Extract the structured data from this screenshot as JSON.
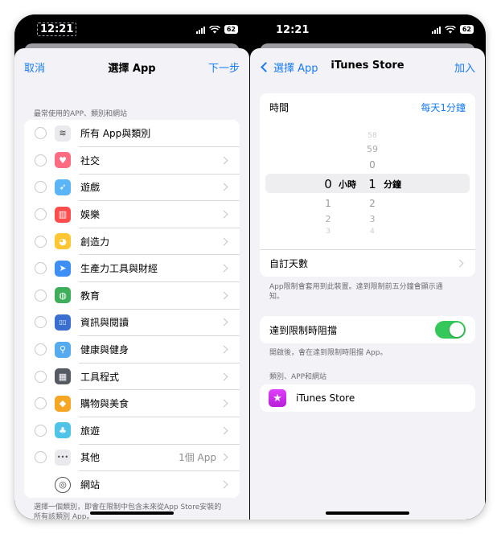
{
  "status": {
    "time": "12:21",
    "battery": "62"
  },
  "left": {
    "nav": {
      "cancel": "取消",
      "title": "選擇 App",
      "next": "下一步"
    },
    "section_header": "最常使用的APP、類別和網站",
    "rows": [
      {
        "label": "所有 App與類別",
        "icon": "stack-icon",
        "glyph": "≋",
        "color": "#e9e9ee",
        "detail": "",
        "chevron": false,
        "radio": true
      },
      {
        "label": "社交",
        "icon": "social-heart-icon",
        "glyph": "♥",
        "color": "#ff6b81",
        "detail": "",
        "chevron": true,
        "radio": true
      },
      {
        "label": "遊戲",
        "icon": "rocket-icon",
        "glyph": "➶",
        "color": "#5ab4f5",
        "detail": "",
        "chevron": true,
        "radio": true
      },
      {
        "label": "娛樂",
        "icon": "popcorn-icon",
        "glyph": "▥",
        "color": "#ff4d4d",
        "detail": "",
        "chevron": true,
        "radio": true
      },
      {
        "label": "創造力",
        "icon": "palette-icon",
        "glyph": "◕",
        "color": "#ffc633",
        "detail": "",
        "chevron": true,
        "radio": true
      },
      {
        "label": "生產力工具與財經",
        "icon": "paper-plane-icon",
        "glyph": "➤",
        "color": "#3d8ff5",
        "detail": "",
        "chevron": true,
        "radio": true
      },
      {
        "label": "教育",
        "icon": "globe-icon",
        "glyph": "◍",
        "color": "#3fae5a",
        "detail": "",
        "chevron": true,
        "radio": true
      },
      {
        "label": "資訊與閱讀",
        "icon": "book-icon",
        "glyph": "▯▯",
        "color": "#3a6fcf",
        "detail": "",
        "chevron": true,
        "radio": true
      },
      {
        "label": "健康與健身",
        "icon": "bicycle-icon",
        "glyph": "⚲",
        "color": "#55aaf0",
        "detail": "",
        "chevron": true,
        "radio": true
      },
      {
        "label": "工具程式",
        "icon": "calculator-icon",
        "glyph": "▦",
        "color": "#555a63",
        "detail": "",
        "chevron": true,
        "radio": true
      },
      {
        "label": "購物與美食",
        "icon": "shopping-bag-icon",
        "glyph": "◆",
        "color": "#f5a623",
        "detail": "",
        "chevron": true,
        "radio": true
      },
      {
        "label": "旅遊",
        "icon": "palm-tree-icon",
        "glyph": "♣",
        "color": "#4fc3e8",
        "detail": "",
        "chevron": true,
        "radio": true
      },
      {
        "label": "其他",
        "icon": "more-dots-icon",
        "glyph": "•••",
        "color": "#e9e9ee",
        "detail": "1個 App",
        "chevron": true,
        "radio": true
      },
      {
        "label": "網站",
        "icon": "compass-icon",
        "glyph": "◎",
        "color": "#ffffff",
        "detail": "",
        "chevron": true,
        "radio": false
      }
    ],
    "footer": "選擇一個類別，即會在限制中包含未來從App Store安裝的所有該類別 App。"
  },
  "right": {
    "nav": {
      "back": "選擇 App",
      "title": "iTunes Store",
      "add": "加入"
    },
    "time": {
      "label": "時間",
      "value": "每天1分鐘"
    },
    "picker": {
      "hours_above": [
        "",
        "",
        ""
      ],
      "hours_selected": "0",
      "hours_unit": "小時",
      "hours_below": [
        "1",
        "2",
        "3"
      ],
      "minutes_above": [
        "58",
        "59",
        "0"
      ],
      "minutes_selected": "1",
      "minutes_unit": "分鐘",
      "minutes_below": [
        "2",
        "3",
        "4"
      ]
    },
    "custom_days": "自訂天數",
    "limit_note": "App限制會套用到此裝置。達到限制前五分鐘會顯示通知。",
    "block": {
      "label": "達到限制時阻擋",
      "on": true
    },
    "block_note": "開啟後，會在達到限制時阻擋 App。",
    "category_header": "類別、APP和網站",
    "store": {
      "label": "iTunes Store"
    }
  }
}
